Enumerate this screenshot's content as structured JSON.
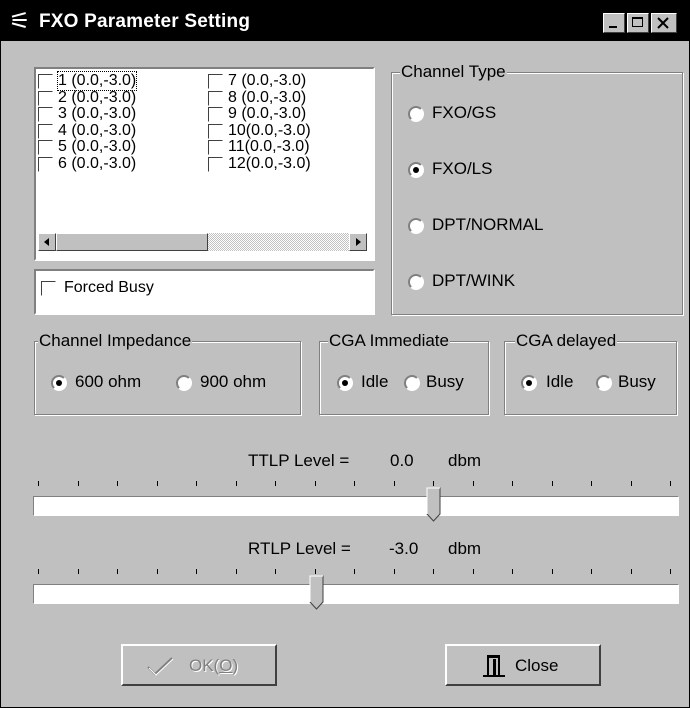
{
  "window": {
    "title": "FXO Parameter Setting",
    "app_icon": "fxo-app-icon"
  },
  "channels": [
    {
      "label": "1 (0.0,-3.0)",
      "checked": false
    },
    {
      "label": "2 (0.0,-3.0)",
      "checked": false
    },
    {
      "label": "3 (0.0,-3.0)",
      "checked": false
    },
    {
      "label": "4 (0.0,-3.0)",
      "checked": false
    },
    {
      "label": "5 (0.0,-3.0)",
      "checked": false
    },
    {
      "label": "6 (0.0,-3.0)",
      "checked": false
    },
    {
      "label": "7 (0.0,-3.0)",
      "checked": false
    },
    {
      "label": "8 (0.0,-3.0)",
      "checked": false
    },
    {
      "label": "9 (0.0,-3.0)",
      "checked": false
    },
    {
      "label": "10(0.0,-3.0)",
      "checked": false
    },
    {
      "label": "11(0.0,-3.0)",
      "checked": false
    },
    {
      "label": "12(0.0,-3.0)",
      "checked": false
    }
  ],
  "forced_busy": {
    "label": "Forced Busy",
    "checked": false
  },
  "channel_type": {
    "legend": "Channel Type",
    "options": [
      "FXO/GS",
      "FXO/LS",
      "DPT/NORMAL",
      "DPT/WINK"
    ],
    "selected": "FXO/LS"
  },
  "impedance": {
    "legend": "Channel Impedance",
    "options": [
      "600 ohm",
      "900 ohm"
    ],
    "selected": "600 ohm"
  },
  "cga_immediate": {
    "legend": "CGA Immediate",
    "options": [
      "Idle",
      "Busy"
    ],
    "selected": "Idle"
  },
  "cga_delayed": {
    "legend": "CGA delayed",
    "options": [
      "Idle",
      "Busy"
    ],
    "selected": "Idle"
  },
  "ttlp": {
    "label": "TTLP Level =",
    "value": "0.0",
    "unit": "dbm",
    "position_fraction": 0.62
  },
  "rtlp": {
    "label": "RTLP Level =",
    "value": "-3.0",
    "unit": "dbm",
    "position_fraction": 0.44
  },
  "buttons": {
    "ok": "OK(O)",
    "ok_underline": "O",
    "close": "Close"
  }
}
